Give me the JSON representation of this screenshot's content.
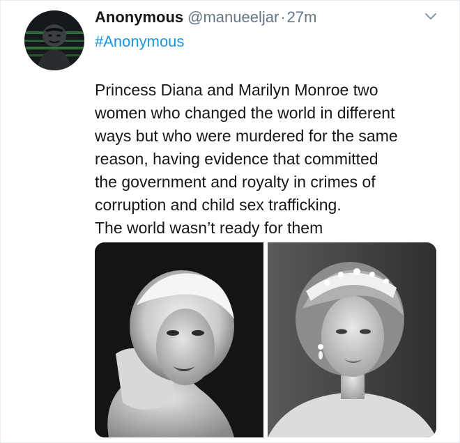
{
  "tweet": {
    "author": {
      "display_name": "Anonymous",
      "handle": "@manueeljar",
      "separator": "·",
      "time": "27m"
    },
    "hashtag": "#Anonymous",
    "text_lines": [
      "Princess Diana and Marilyn Monroe two",
      "women who changed the world in different",
      "ways but who were murdered for the same",
      "reason, having evidence that committed",
      "the government and royalty in crimes of",
      "corruption and child sex trafficking.",
      "The world wasn’t ready for them"
    ],
    "colors": {
      "link": "#1b95e0",
      "secondary_text": "#657786",
      "primary_text": "#14171a"
    },
    "icons": {
      "menu": "chevron-down-icon",
      "avatar": "masked-face-avatar"
    }
  }
}
